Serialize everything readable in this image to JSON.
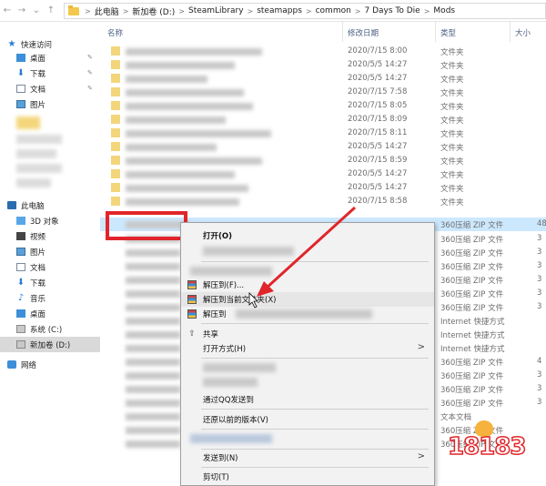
{
  "address": {
    "crumbs": [
      "此电脑",
      "新加卷 (D:)",
      "SteamLibrary",
      "steamapps",
      "common",
      "7 Days To Die",
      "Mods"
    ],
    "separator": ">"
  },
  "nav": {
    "items": [
      {
        "label": "快速访问",
        "icon": "star-icon"
      },
      {
        "label": "桌面",
        "icon": "desktop-icon"
      },
      {
        "label": "下载",
        "icon": "download-icon"
      },
      {
        "label": "文档",
        "icon": "document-icon"
      },
      {
        "label": "图片",
        "icon": "picture-icon"
      },
      {
        "label": "此电脑",
        "icon": "computer-icon"
      },
      {
        "label": "3D 对象",
        "icon": "cube-icon"
      },
      {
        "label": "视频",
        "icon": "video-icon"
      },
      {
        "label": "图片",
        "icon": "picture-icon"
      },
      {
        "label": "文档",
        "icon": "document-icon"
      },
      {
        "label": "下载",
        "icon": "download-icon"
      },
      {
        "label": "音乐",
        "icon": "music-icon"
      },
      {
        "label": "桌面",
        "icon": "desktop-icon"
      },
      {
        "label": "系统 (C:)",
        "icon": "drive-icon"
      },
      {
        "label": "新加卷 (D:)",
        "icon": "drive-icon"
      },
      {
        "label": "网络",
        "icon": "network-icon"
      }
    ]
  },
  "columns": {
    "name": "名称",
    "date": "修改日期",
    "type": "类型",
    "size": "大小"
  },
  "rows": [
    {
      "date": "2020/7/15 8:00",
      "type": "文件夹",
      "size": ""
    },
    {
      "date": "2020/5/5 14:27",
      "type": "文件夹",
      "size": ""
    },
    {
      "date": "2020/5/5 14:27",
      "type": "文件夹",
      "size": ""
    },
    {
      "date": "2020/7/15 7:58",
      "type": "文件夹",
      "size": ""
    },
    {
      "date": "2020/7/15 8:05",
      "type": "文件夹",
      "size": ""
    },
    {
      "date": "2020/7/15 8:09",
      "type": "文件夹",
      "size": ""
    },
    {
      "date": "2020/7/15 8:11",
      "type": "文件夹",
      "size": ""
    },
    {
      "date": "2020/5/5 14:27",
      "type": "文件夹",
      "size": ""
    },
    {
      "date": "2020/7/15 8:59",
      "type": "文件夹",
      "size": ""
    },
    {
      "date": "2020/5/5 14:27",
      "type": "文件夹",
      "size": ""
    },
    {
      "date": "2020/5/5 14:27",
      "type": "文件夹",
      "size": ""
    },
    {
      "date": "2020/7/15 8:58",
      "type": "文件夹",
      "size": ""
    },
    {
      "date": "",
      "type": "360压缩 ZIP 文件",
      "size": "48"
    },
    {
      "date": "",
      "type": "360压缩 ZIP 文件",
      "size": "3"
    },
    {
      "date": "",
      "type": "360压缩 ZIP 文件",
      "size": "3"
    },
    {
      "date": "",
      "type": "360压缩 ZIP 文件",
      "size": "3"
    },
    {
      "date": "",
      "type": "360压缩 ZIP 文件",
      "size": "3"
    },
    {
      "date": "",
      "type": "360压缩 ZIP 文件",
      "size": "3"
    },
    {
      "date": "",
      "type": "360压缩 ZIP 文件",
      "size": "3"
    },
    {
      "date": "",
      "type": "Internet 快捷方式",
      "size": ""
    },
    {
      "date": "",
      "type": "Internet 快捷方式",
      "size": ""
    },
    {
      "date": "",
      "type": "Internet 快捷方式",
      "size": ""
    },
    {
      "date": "",
      "type": "360压缩 ZIP 文件",
      "size": "4"
    },
    {
      "date": "",
      "type": "360压缩 ZIP 文件",
      "size": "3"
    },
    {
      "date": "",
      "type": "360压缩 ZIP 文件",
      "size": "3"
    },
    {
      "date": "",
      "type": "360压缩 ZIP 文件",
      "size": "3"
    },
    {
      "date": "",
      "type": "文本文档",
      "size": ""
    },
    {
      "date": "",
      "type": "360压缩 ZIP 文件",
      "size": ""
    },
    {
      "date": "",
      "type": "360压缩 ZIP 文件",
      "size": ""
    }
  ],
  "context_menu": {
    "open": "打开(O)",
    "extract_to": "解压到(F)...",
    "extract_here": "解压到当前文件夹(X)",
    "extract_to_folder": "解压到",
    "share": "共享",
    "open_with": "打开方式(H)",
    "send_qq": "通过QQ发送到",
    "restore": "还原以前的版本(V)",
    "send_to": "发送到(N)",
    "cut": "剪切(T)",
    "submenu_arrow": ">"
  },
  "watermark": {
    "text": "18183"
  },
  "colors": {
    "highlight_red": "#e0262b",
    "selection_blue": "#cce8ff",
    "menu_bg": "#f2f2f2"
  }
}
